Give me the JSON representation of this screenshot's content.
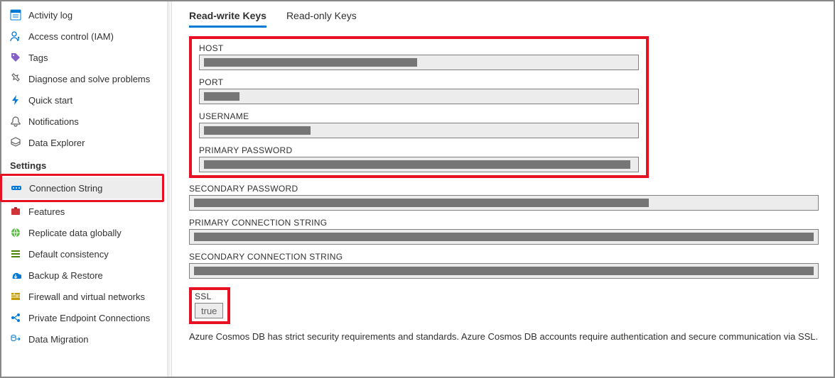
{
  "sidebar": {
    "top": [
      {
        "icon": "activity-log-icon",
        "label": "Activity log"
      },
      {
        "icon": "access-control-icon",
        "label": "Access control (IAM)"
      },
      {
        "icon": "tags-icon",
        "label": "Tags"
      },
      {
        "icon": "diagnose-icon",
        "label": "Diagnose and solve problems"
      },
      {
        "icon": "quick-start-icon",
        "label": "Quick start"
      },
      {
        "icon": "notifications-icon",
        "label": "Notifications"
      },
      {
        "icon": "data-explorer-icon",
        "label": "Data Explorer"
      }
    ],
    "settings_header": "Settings",
    "settings": [
      {
        "icon": "connection-string-icon",
        "label": "Connection String",
        "active": true,
        "highlighted": true
      },
      {
        "icon": "features-icon",
        "label": "Features"
      },
      {
        "icon": "replicate-icon",
        "label": "Replicate data globally"
      },
      {
        "icon": "consistency-icon",
        "label": "Default consistency"
      },
      {
        "icon": "backup-icon",
        "label": "Backup & Restore"
      },
      {
        "icon": "firewall-icon",
        "label": "Firewall and virtual networks"
      },
      {
        "icon": "private-endpoint-icon",
        "label": "Private Endpoint Connections"
      },
      {
        "icon": "data-migration-icon",
        "label": "Data Migration"
      }
    ]
  },
  "main": {
    "tabs": [
      {
        "label": "Read-write Keys",
        "active": true
      },
      {
        "label": "Read-only Keys",
        "active": false
      }
    ],
    "fields_highlighted": [
      {
        "label": "HOST",
        "redact_w": 300
      },
      {
        "label": "PORT",
        "redact_w": 50
      },
      {
        "label": "USERNAME",
        "redact_w": 150
      },
      {
        "label": "PRIMARY PASSWORD",
        "redact_w": 600
      }
    ],
    "fields_lower": [
      {
        "label": "SECONDARY PASSWORD",
        "redact_w": 640
      },
      {
        "label": "PRIMARY CONNECTION STRING",
        "redact_w": 876
      },
      {
        "label": "SECONDARY CONNECTION STRING",
        "redact_w": 876
      }
    ],
    "ssl": {
      "label": "SSL",
      "value": "true"
    },
    "footer": "Azure Cosmos DB has strict security requirements and standards. Azure Cosmos DB accounts require authentication and secure communication via SSL."
  },
  "icons": {
    "activity-log-icon": "#0078d4",
    "access-control-icon": "#0078d4",
    "tags-icon": "#8661c5",
    "diagnose-icon": "#616161",
    "quick-start-icon": "#0078d4",
    "notifications-icon": "#605e5c",
    "data-explorer-icon": "#605e5c",
    "connection-string-icon": "#0078d4",
    "features-icon": "#d13438",
    "replicate-icon": "#5cba47",
    "consistency-icon": "#498205",
    "backup-icon": "#0078d4",
    "firewall-icon": "#c19c00",
    "private-endpoint-icon": "#0078d4",
    "data-migration-icon": "#0078d4"
  }
}
